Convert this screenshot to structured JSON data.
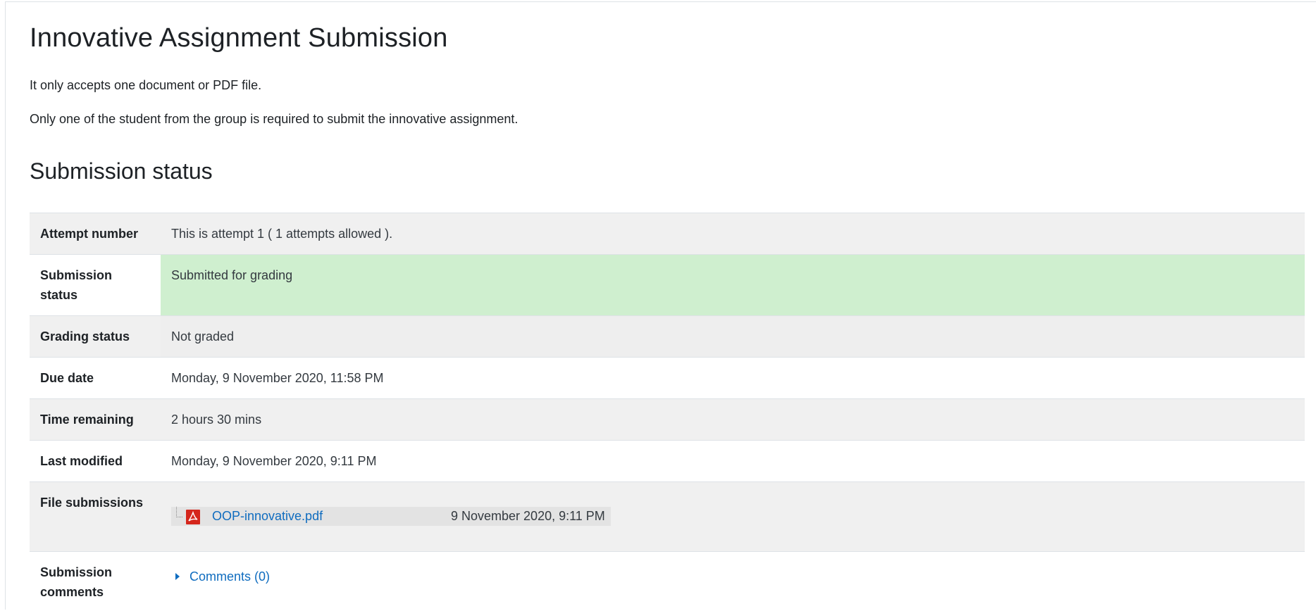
{
  "page": {
    "title": "Innovative Assignment Submission",
    "intro": [
      "It only accepts one document or PDF file.",
      "Only one of the student from the group is required to submit the innovative assignment."
    ]
  },
  "status": {
    "heading": "Submission status",
    "rows": {
      "attempt": {
        "label": "Attempt number",
        "value": "This is attempt 1 ( 1 attempts allowed )."
      },
      "submission": {
        "label": "Submission status",
        "value": "Submitted for grading"
      },
      "grading": {
        "label": "Grading status",
        "value": "Not graded"
      },
      "due": {
        "label": "Due date",
        "value": "Monday, 9 November 2020, 11:58 PM"
      },
      "remaining": {
        "label": "Time remaining",
        "value": "2 hours 30 mins"
      },
      "modified": {
        "label": "Last modified",
        "value": "Monday, 9 November 2020, 9:11 PM"
      },
      "files": {
        "label": "File submissions",
        "file_name": "OOP-innovative.pdf",
        "file_date": "9 November 2020, 9:11 PM",
        "file_icon": "pdf-icon"
      },
      "comments": {
        "label": "Submission comments",
        "link": "Comments (0)",
        "icon": "caret-right-icon"
      }
    }
  },
  "colors": {
    "submitted_bg": "#cfefcf",
    "link": "#0f6cbf",
    "alt_row": "#f0f0f0"
  }
}
